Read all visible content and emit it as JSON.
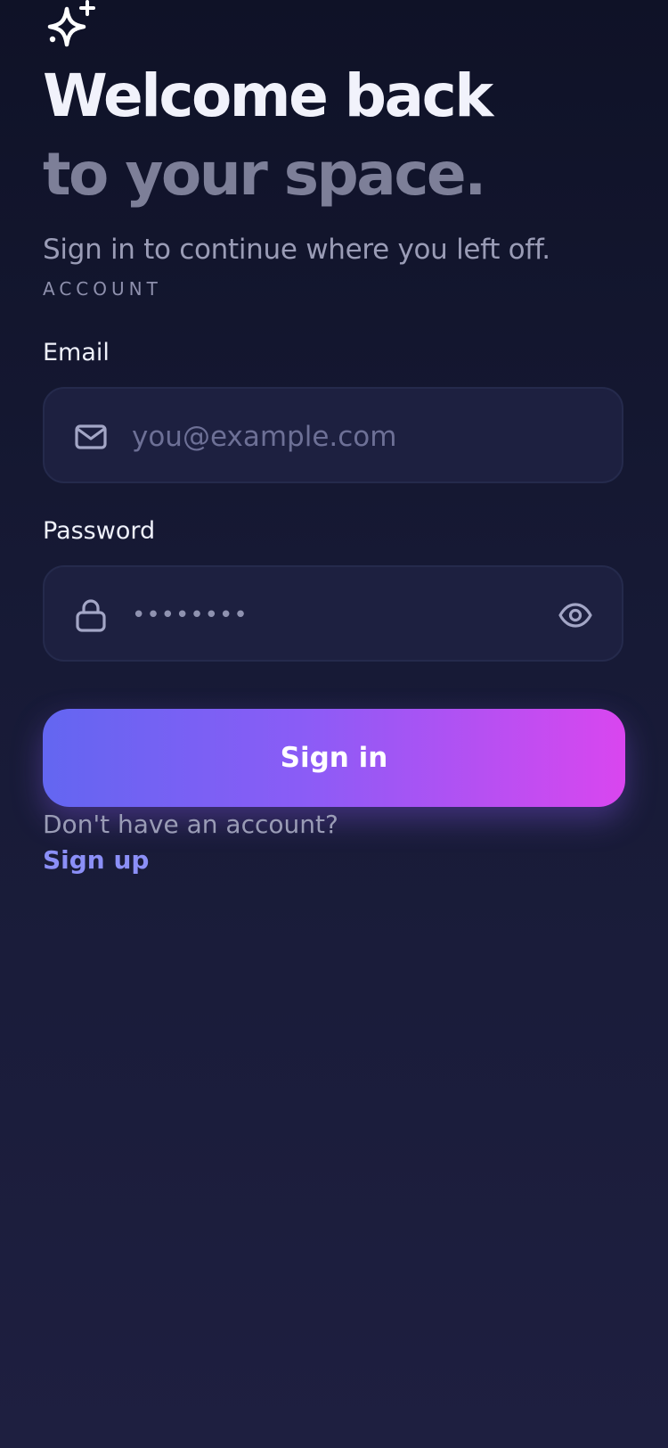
{
  "hero": {
    "title_line1": "Welcome back",
    "title_line2": "to your space.",
    "subtitle": "Sign in to continue where you left off.",
    "section_label": "ACCOUNT"
  },
  "form": {
    "email": {
      "label": "Email",
      "placeholder": "you@example.com",
      "icon": "mail-icon"
    },
    "password": {
      "label": "Password",
      "masked_value": "••••••••",
      "icon": "lock-icon",
      "toggle_icon": "eye-icon"
    },
    "submit_label": "Sign in"
  },
  "footer": {
    "prompt": "Don't have an account?",
    "link_label": "Sign up"
  },
  "colors": {
    "accent_start": "#6366f1",
    "accent_mid": "#8b5cf6",
    "accent_end": "#d946ef",
    "link": "#8b8ff7",
    "background_top": "#0f1227",
    "background_bottom": "#1e1f40"
  },
  "icons": {
    "logo": "sparkle-icon"
  }
}
